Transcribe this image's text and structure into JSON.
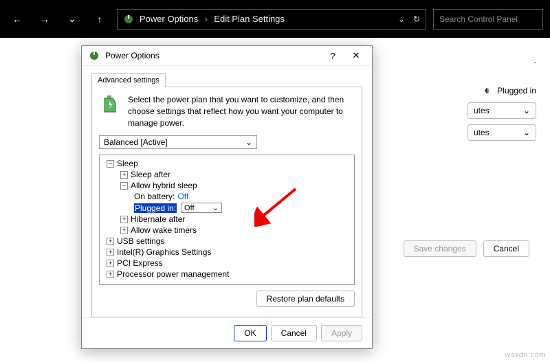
{
  "titlebar": {
    "breadcrumb1": "Power Options",
    "breadcrumb2": "Edit Plan Settings",
    "search_placeholder": "Search Control Panel"
  },
  "bg": {
    "plugged": "Plugged in",
    "utes": "utes",
    "save": "Save changes",
    "cancel": "Cancel"
  },
  "dialog": {
    "title": "Power Options",
    "tab": "Advanced settings",
    "intro": "Select the power plan that you want to customize, and then choose settings that reflect how you want your computer to manage power.",
    "plan": "Balanced [Active]",
    "tree": {
      "sleep": "Sleep",
      "sleep_after": "Sleep after",
      "allow_hybrid": "Allow hybrid sleep",
      "on_battery_label": "On battery:",
      "on_battery_value": "Off",
      "plugged_label": "Plugged in:",
      "plugged_value": "Off",
      "hibernate": "Hibernate after",
      "wake_timers": "Allow wake timers",
      "usb": "USB settings",
      "intel": "Intel(R) Graphics Settings",
      "pci": "PCI Express",
      "cpu": "Processor power management"
    },
    "restore": "Restore plan defaults",
    "ok": "OK",
    "cancel": "Cancel",
    "apply": "Apply"
  },
  "watermark": "wsxdn.com"
}
